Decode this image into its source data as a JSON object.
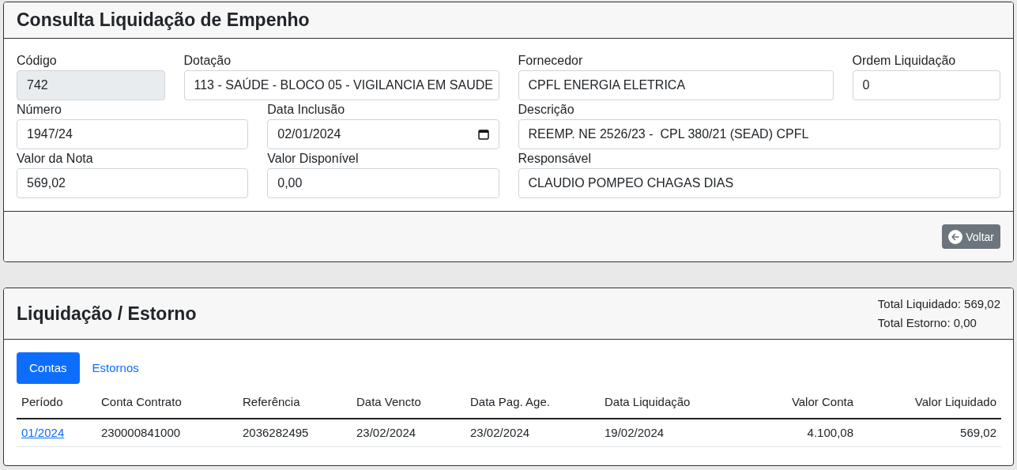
{
  "header": {
    "title": "Consulta Liquidação de Empenho"
  },
  "fields": [
    {
      "label": "Código",
      "value": "742",
      "kind": "text",
      "disabled": true
    },
    {
      "label": "Dotação",
      "value": "113 - SAÚDE - BLOCO 05 - VIGILANCIA EM SAUDE",
      "kind": "text",
      "disabled": false
    },
    {
      "label": "Fornecedor",
      "value": "CPFL ENERGIA ELETRICA",
      "kind": "text",
      "disabled": false
    },
    {
      "label": "Ordem Liquidação",
      "value": "0",
      "kind": "text",
      "disabled": false
    },
    {
      "label": "Número",
      "value": "1947/24",
      "kind": "text",
      "disabled": false
    },
    {
      "label": "Data Inclusão",
      "value": "02/01/2024",
      "kind": "date",
      "disabled": false
    },
    {
      "label": "Descrição",
      "value": "REEMP. NE 2526/23 -  CPL 380/21 (SEAD) CPFL",
      "kind": "text",
      "disabled": false
    },
    {
      "label": "Valor da Nota",
      "value": "569,02",
      "kind": "text",
      "disabled": false
    },
    {
      "label": "Valor Disponível",
      "value": "0,00",
      "kind": "text",
      "disabled": false
    },
    {
      "label": "Responsável",
      "value": "CLAUDIO POMPEO CHAGAS DIAS",
      "kind": "text",
      "disabled": false
    }
  ],
  "footer": {
    "back_button": "Voltar"
  },
  "section": {
    "title": "Liquidação / Estorno",
    "totals": [
      "Total Liquidado: 569,02",
      "Total Estorno: 0,00"
    ]
  },
  "tabs": [
    {
      "label": "Contas",
      "selected": true
    },
    {
      "label": "Estornos",
      "selected": false
    }
  ],
  "table": {
    "columns": [
      "Período",
      "Conta Contrato",
      "Referência",
      "Data Vencto",
      "Data Pag. Age.",
      "Data Liquidação",
      "Valor Conta",
      "Valor Liquidado"
    ],
    "rows": [
      {
        "cells": [
          {
            "text": "01/2024",
            "kind": "link"
          },
          {
            "text": "230000841000",
            "kind": "text"
          },
          {
            "text": "2036282495",
            "kind": "text"
          },
          {
            "text": "23/02/2024",
            "kind": "text"
          },
          {
            "text": "23/02/2024",
            "kind": "text"
          },
          {
            "text": "19/02/2024",
            "kind": "text"
          },
          {
            "text": "4.100,08",
            "kind": "text"
          },
          {
            "text": "569,02",
            "kind": "text"
          }
        ]
      }
    ]
  }
}
